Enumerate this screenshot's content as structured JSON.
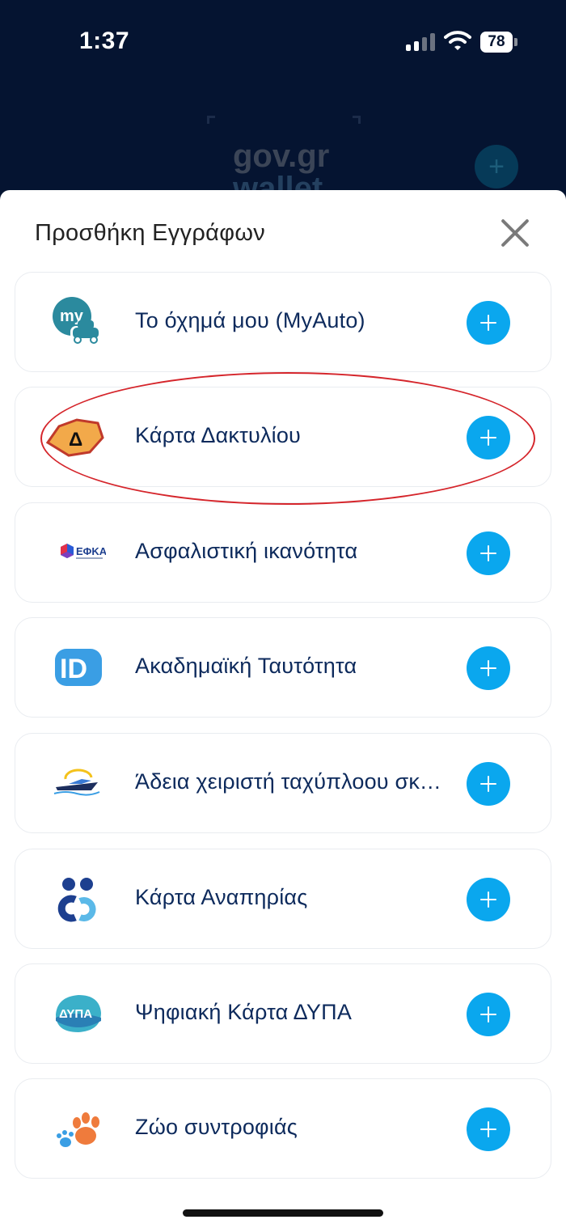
{
  "status_bar": {
    "time": "1:37",
    "battery": "78"
  },
  "background": {
    "logo_top": "gov.gr",
    "logo_bottom": "wallet",
    "add_symbol": "+"
  },
  "sheet": {
    "title": "Προσθήκη Εγγράφων",
    "items": [
      {
        "label": "Το όχημά μου (MyAuto)",
        "icon": "myauto-icon"
      },
      {
        "label": "Κάρτα Δακτυλίου",
        "icon": "ring-card-icon",
        "icon_text": "Δ"
      },
      {
        "label": "Ασφαλιστική ικανότητα",
        "icon": "efka-icon",
        "icon_text": "ΕΦΚΑ"
      },
      {
        "label": "Ακαδημαϊκή Ταυτότητα",
        "icon": "academic-id-icon",
        "icon_text": "ID"
      },
      {
        "label": "Άδεια χειριστή ταχύπλοου σκάφους",
        "icon": "speedboat-icon"
      },
      {
        "label": "Κάρτα Αναπηρίας",
        "icon": "disability-card-icon"
      },
      {
        "label": "Ψηφιακή Κάρτα ΔΥΠΑ",
        "icon": "dypa-icon",
        "icon_text": "ΔΥΠΑ"
      },
      {
        "label": "Ζώο συντροφιάς",
        "icon": "pet-paw-icon"
      }
    ]
  },
  "colors": {
    "accent": "#0aa7ee",
    "highlight": "#d5252b",
    "text": "#0d2a5c",
    "backdrop": "#051431"
  }
}
